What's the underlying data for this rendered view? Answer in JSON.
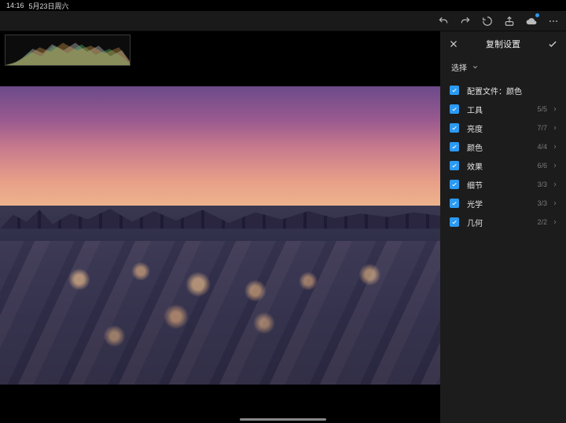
{
  "status": {
    "time": "14:16",
    "date": "5月23日周六"
  },
  "panel": {
    "title": "复制设置",
    "select_label": "选择",
    "items": [
      {
        "label": "配置文件：颜色",
        "count": ""
      },
      {
        "label": "工具",
        "count": "5/5"
      },
      {
        "label": "亮度",
        "count": "7/7"
      },
      {
        "label": "颜色",
        "count": "4/4"
      },
      {
        "label": "效果",
        "count": "6/6"
      },
      {
        "label": "细节",
        "count": "3/3"
      },
      {
        "label": "光学",
        "count": "3/3"
      },
      {
        "label": "几何",
        "count": "2/2"
      }
    ]
  }
}
